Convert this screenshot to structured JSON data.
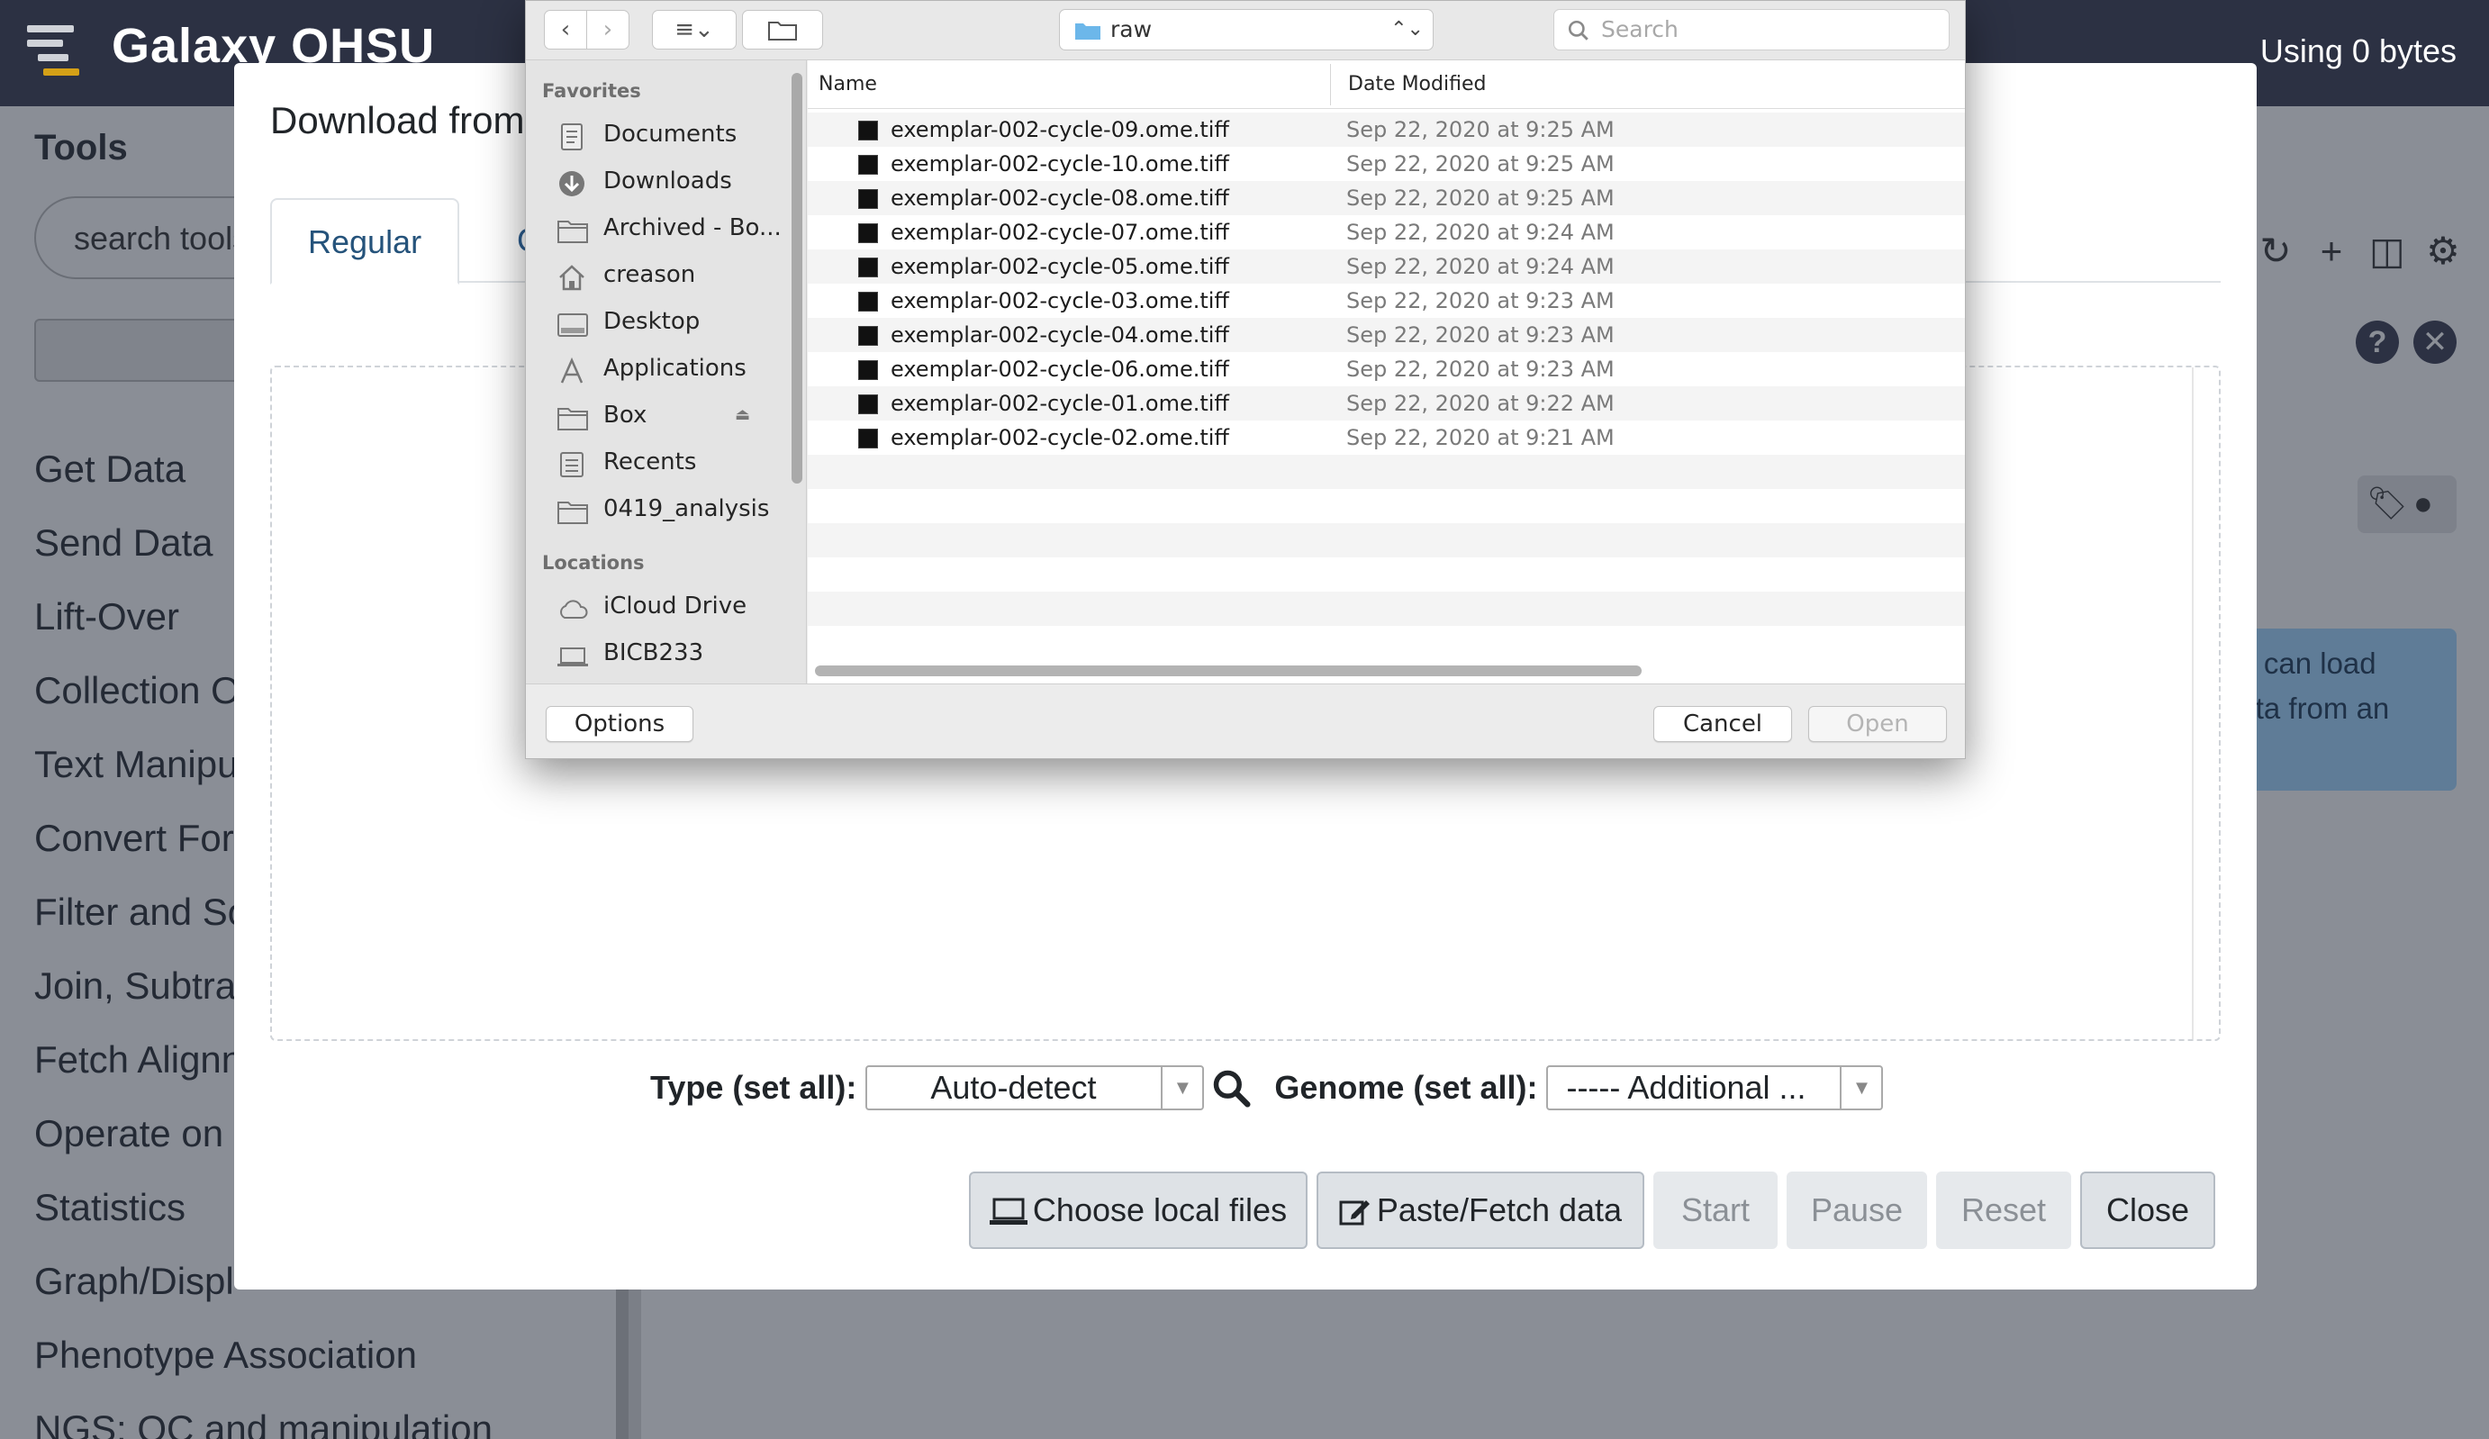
{
  "app": {
    "title": "Galaxy OHSU",
    "quota": "Using 0 bytes"
  },
  "tool_panel": {
    "title": "Tools",
    "search_placeholder": "search tools",
    "sections": [
      "Get Data",
      "Send Data",
      "Lift-Over",
      "Collection O",
      "Text Manipu",
      "Convert For",
      "Filter and So",
      "Join, Subtra",
      "Fetch Alignn",
      "Operate on",
      "Statistics",
      "Graph/Displ",
      "Phenotype Association",
      "NGS: QC and manipulation"
    ]
  },
  "center": {
    "welcome_text_line1": "ou can load",
    "welcome_text_line2": "data from an"
  },
  "upload_modal": {
    "title": "Download from",
    "tabs": [
      "Regular",
      "Co"
    ],
    "type_label": "Type (set all):",
    "type_value": "Auto-detect",
    "genome_label": "Genome (set all):",
    "genome_value": "----- Additional ...",
    "buttons": {
      "choose_local": "Choose local files",
      "paste_fetch": "Paste/Fetch data",
      "start": "Start",
      "pause": "Pause",
      "reset": "Reset",
      "close": "Close"
    }
  },
  "file_dialog": {
    "current_folder": "raw",
    "search_placeholder": "Search",
    "sidebar": {
      "favorites_heading": "Favorites",
      "favorites": [
        {
          "label": "Documents",
          "icon": "documents-icon"
        },
        {
          "label": "Downloads",
          "icon": "downloads-icon"
        },
        {
          "label": "Archived - Bo...",
          "icon": "folder-icon"
        },
        {
          "label": "creason",
          "icon": "home-icon"
        },
        {
          "label": "Desktop",
          "icon": "desktop-icon"
        },
        {
          "label": "Applications",
          "icon": "applications-icon"
        },
        {
          "label": "Box",
          "icon": "folder-icon"
        },
        {
          "label": "Recents",
          "icon": "recents-icon"
        },
        {
          "label": "0419_analysis",
          "icon": "folder-icon"
        }
      ],
      "locations_heading": "Locations",
      "locations": [
        {
          "label": "iCloud Drive",
          "icon": "cloud-icon"
        },
        {
          "label": "BICB233",
          "icon": "laptop-icon"
        }
      ]
    },
    "columns": {
      "name": "Name",
      "date": "Date Modified"
    },
    "files": [
      {
        "name": "exemplar-002-cycle-09.ome.tiff",
        "date": "Sep 22, 2020 at 9:25 AM"
      },
      {
        "name": "exemplar-002-cycle-10.ome.tiff",
        "date": "Sep 22, 2020 at 9:25 AM"
      },
      {
        "name": "exemplar-002-cycle-08.ome.tiff",
        "date": "Sep 22, 2020 at 9:25 AM"
      },
      {
        "name": "exemplar-002-cycle-07.ome.tiff",
        "date": "Sep 22, 2020 at 9:24 AM"
      },
      {
        "name": "exemplar-002-cycle-05.ome.tiff",
        "date": "Sep 22, 2020 at 9:24 AM"
      },
      {
        "name": "exemplar-002-cycle-03.ome.tiff",
        "date": "Sep 22, 2020 at 9:23 AM"
      },
      {
        "name": "exemplar-002-cycle-04.ome.tiff",
        "date": "Sep 22, 2020 at 9:23 AM"
      },
      {
        "name": "exemplar-002-cycle-06.ome.tiff",
        "date": "Sep 22, 2020 at 9:23 AM"
      },
      {
        "name": "exemplar-002-cycle-01.ome.tiff",
        "date": "Sep 22, 2020 at 9:22 AM"
      },
      {
        "name": "exemplar-002-cycle-02.ome.tiff",
        "date": "Sep 22, 2020 at 9:21 AM"
      }
    ],
    "buttons": {
      "options": "Options",
      "cancel": "Cancel",
      "open": "Open"
    }
  }
}
